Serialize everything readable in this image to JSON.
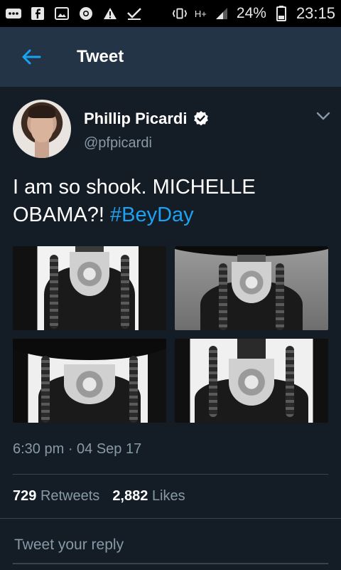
{
  "status_bar": {
    "battery": "24%",
    "time": "23:15",
    "network": "H+",
    "icons": [
      "more-icon",
      "facebook-icon",
      "gallery-icon",
      "chrome-icon",
      "warning-icon",
      "checkmark-icon",
      "vibrate-icon",
      "signal-icon",
      "battery-icon"
    ]
  },
  "app_bar": {
    "title": "Tweet",
    "back_icon": "arrow-left-icon"
  },
  "tweet": {
    "author_name": "Phillip Picardi",
    "handle": "@pfpicardi",
    "verified": true,
    "text_plain": "I am so shook. MICHELLE OBAMA?! ",
    "hashtag": "#BeyDay",
    "media_count": 4,
    "timestamp": "6:30 pm · 04 Sep 17"
  },
  "stats": {
    "retweets_count": "729",
    "retweets_label": "Retweets",
    "likes_count": "2,882",
    "likes_label": "Likes"
  },
  "reply": {
    "placeholder": "Tweet your reply"
  },
  "colors": {
    "background": "#141d26",
    "app_bar": "#243447",
    "accent": "#1da1f2",
    "secondary_text": "#8899a6",
    "divider": "#38444d"
  }
}
